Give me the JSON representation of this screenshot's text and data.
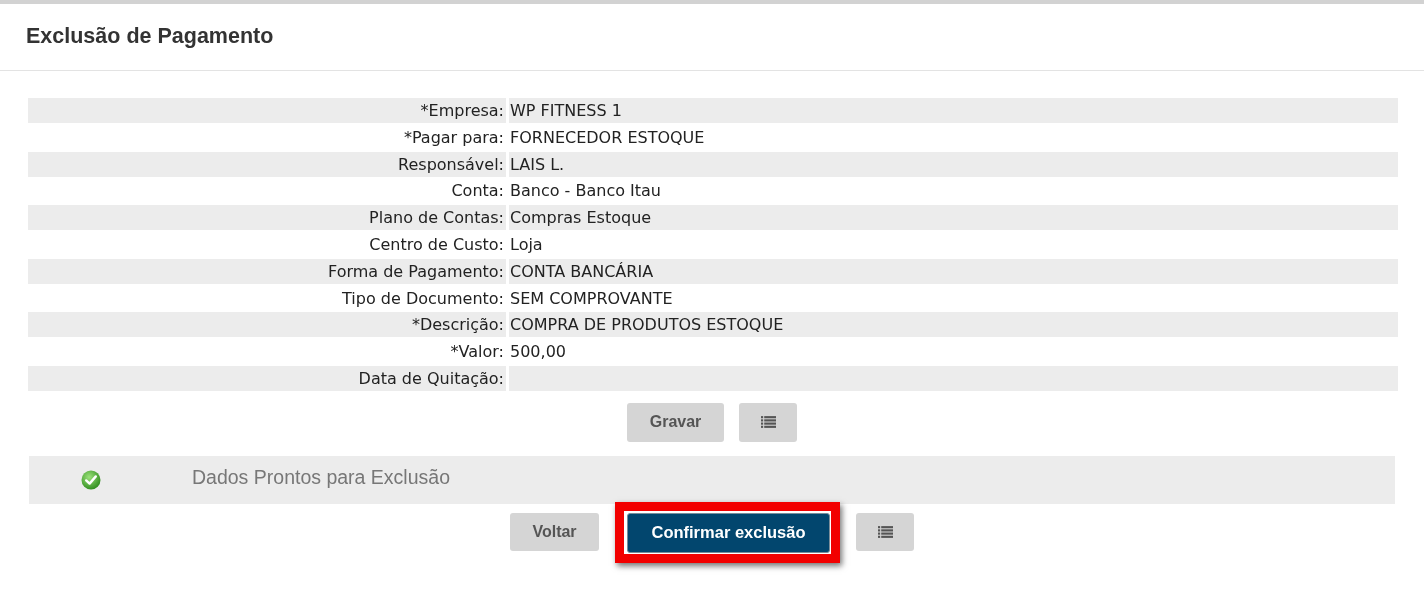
{
  "header": {
    "title": "Exclusão de Pagamento"
  },
  "fields": [
    {
      "label": "*Empresa:",
      "value": "WP FITNESS 1"
    },
    {
      "label": "*Pagar para:",
      "value": "FORNECEDOR ESTOQUE"
    },
    {
      "label": "Responsável:",
      "value": "LAIS L."
    },
    {
      "label": "Conta:",
      "value": "Banco - Banco Itau"
    },
    {
      "label": "Plano de Contas:",
      "value": "Compras Estoque"
    },
    {
      "label": "Centro de Custo:",
      "value": "Loja"
    },
    {
      "label": "Forma de Pagamento:",
      "value": "CONTA BANCÁRIA"
    },
    {
      "label": "Tipo de Documento:",
      "value": "SEM COMPROVANTE"
    },
    {
      "label": "*Descrição:",
      "value": "COMPRA DE PRODUTOS ESTOQUE"
    },
    {
      "label": "*Valor:",
      "value": "500,00"
    },
    {
      "label": "Data de Quitação:"
    }
  ],
  "form_actions": [
    {
      "kind": "text",
      "label": "Gravar"
    },
    {
      "kind": "list"
    }
  ],
  "status": {
    "kind": "success",
    "message": "Dados Prontos para Exclusão"
  },
  "actions": [
    {
      "kind": "secondary",
      "label": "Voltar",
      "highlighted": false
    },
    {
      "kind": "primary",
      "label": "Confirmar exclusão",
      "highlighted": true
    },
    {
      "kind": "list",
      "highlighted": false
    }
  ]
}
